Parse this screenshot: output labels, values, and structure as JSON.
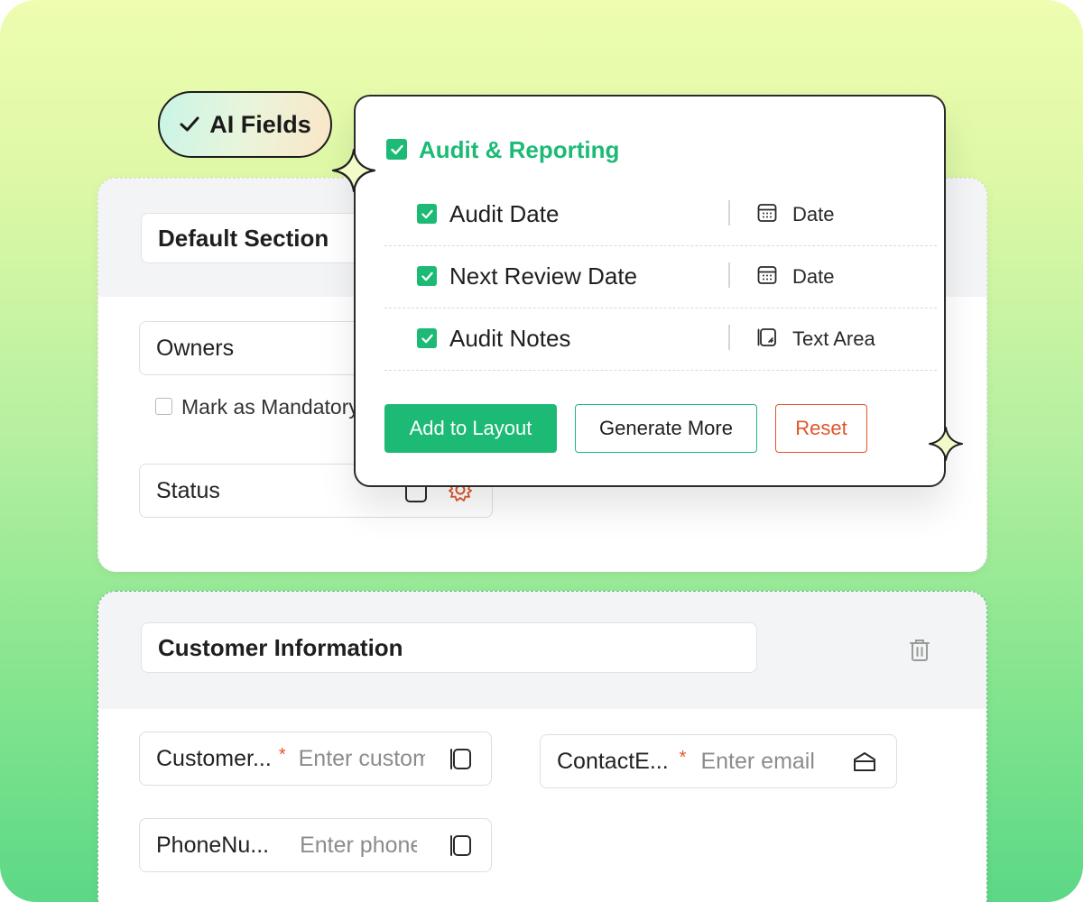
{
  "ai_badge": {
    "label": "AI Fields"
  },
  "popup": {
    "group_title": "Audit & Reporting",
    "fields": [
      {
        "name": "Audit Date",
        "type": "Date",
        "type_icon": "calendar-icon",
        "checked": true
      },
      {
        "name": "Next Review Date",
        "type": "Date",
        "type_icon": "calendar-icon",
        "checked": true
      },
      {
        "name": "Audit Notes",
        "type": "Text Area",
        "type_icon": "text-area-icon",
        "checked": true
      }
    ],
    "buttons": {
      "add": "Add to Layout",
      "generate": "Generate More",
      "reset": "Reset"
    }
  },
  "section1": {
    "title": "Default Section",
    "owners_label": "Owners",
    "mandatory_label": "Mark as Mandatory",
    "status_label": "Status"
  },
  "section2": {
    "title": "Customer Information",
    "fields": [
      {
        "label": "Customer...",
        "required": "*",
        "placeholder": "Enter customer"
      },
      {
        "label": "ContactE...",
        "required": "*",
        "placeholder": "Enter email"
      },
      {
        "label": "PhoneNu...",
        "placeholder": "Enter phone"
      }
    ]
  },
  "colors": {
    "accent": "#1dba76",
    "danger": "#e0552b"
  }
}
